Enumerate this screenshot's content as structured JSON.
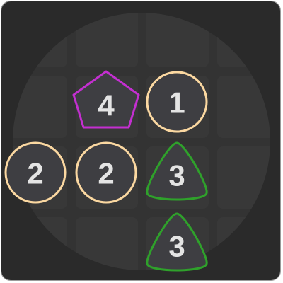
{
  "colors": {
    "background": "#2a2a2a",
    "board_disc": "#333333",
    "empty_cell": "#383838",
    "tile_fill": "#3e3e42",
    "border_circle": "#fbd8a1",
    "border_pentagon": "#c42fd1",
    "border_triangle": "#2fa12b"
  },
  "tiles": [
    {
      "id": "tile-4-pentagon",
      "shape": "pentagon",
      "number": "4"
    },
    {
      "id": "tile-1-circle",
      "shape": "circle",
      "number": "1"
    },
    {
      "id": "tile-2-circle-left",
      "shape": "circle",
      "number": "2"
    },
    {
      "id": "tile-2-circle-center",
      "shape": "circle",
      "number": "2"
    },
    {
      "id": "tile-3-triangle-upper",
      "shape": "triangle",
      "number": "3"
    },
    {
      "id": "tile-3-triangle-lower",
      "shape": "triangle",
      "number": "3"
    }
  ]
}
